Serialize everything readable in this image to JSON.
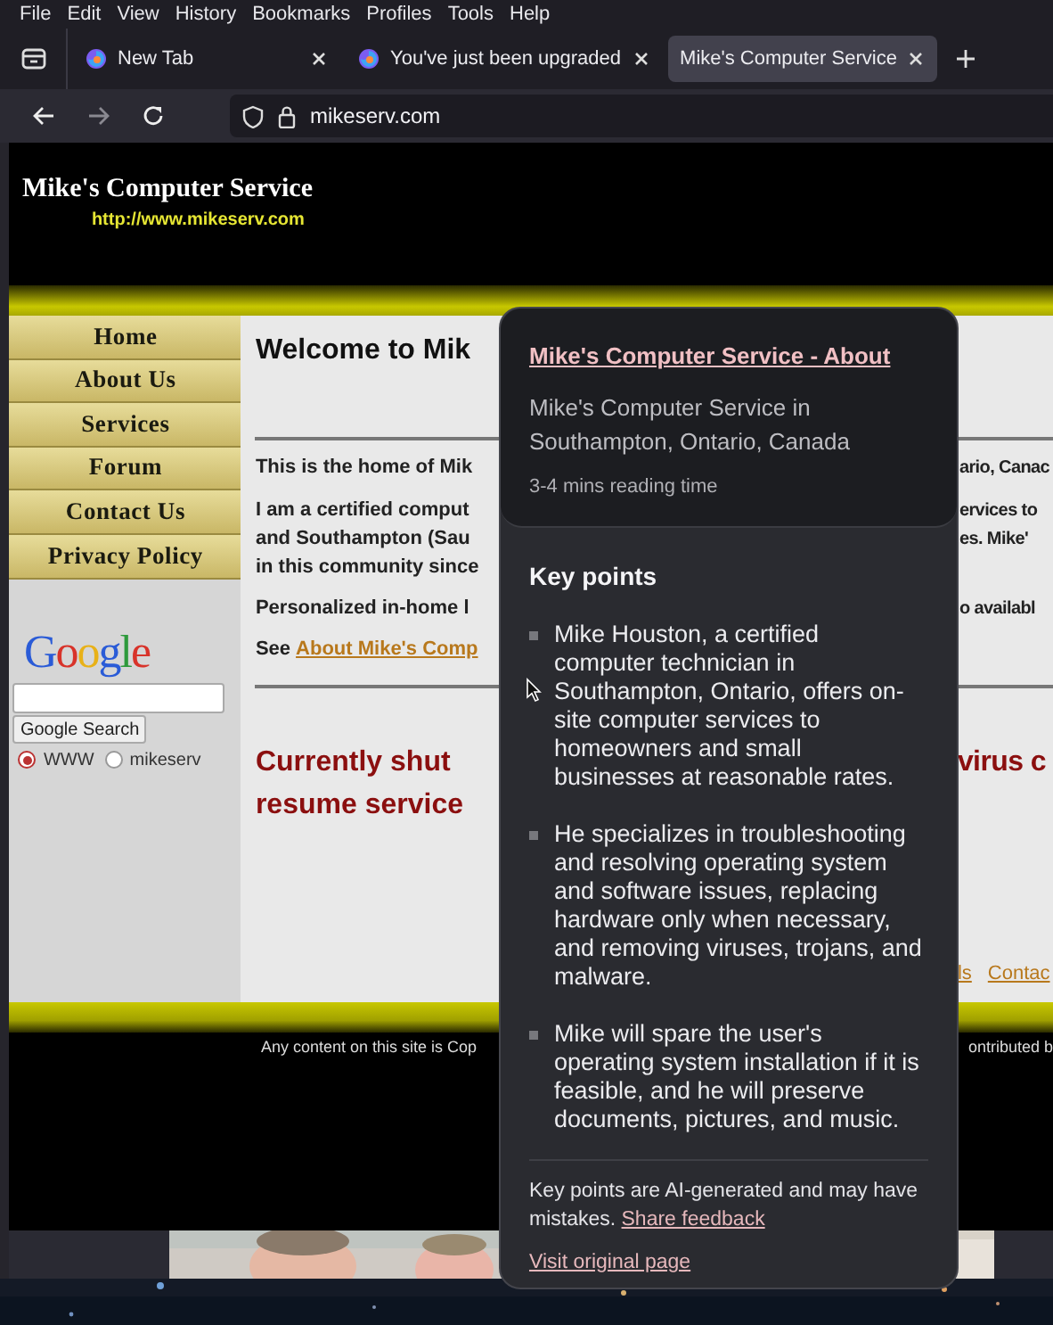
{
  "menu_bar": [
    "File",
    "Edit",
    "View",
    "History",
    "Bookmarks",
    "Profiles",
    "Tools",
    "Help"
  ],
  "tabs": [
    {
      "title": "New Tab",
      "selected": false
    },
    {
      "title": "You've just been upgraded",
      "selected": false
    },
    {
      "title": "Mike's Computer Service",
      "selected": true
    }
  ],
  "address_bar": {
    "url": "mikeserv.com"
  },
  "site": {
    "title": "Mike's Computer Service",
    "url": "http://www.mikeserv.com",
    "nav": [
      "Home",
      "About Us",
      "Services",
      "Forum",
      "Contact Us",
      "Privacy Policy"
    ],
    "search": {
      "logo": "Google",
      "button": "Google Search",
      "options": [
        {
          "label": "WWW",
          "selected": true
        },
        {
          "label": "mikeserv",
          "selected": false
        }
      ]
    },
    "content": [
      {
        "kind": "heading",
        "left": "Welcome to Mik"
      },
      {
        "kind": "rule"
      },
      {
        "kind": "text",
        "left": "This is the home of Mik",
        "right": "ario, Canac"
      },
      {
        "kind": "para",
        "left": "I am a certified comput",
        "right": "ervices to"
      },
      {
        "kind": "line",
        "left": "and Southampton (Sau",
        "right": "es. Mike'"
      },
      {
        "kind": "line",
        "left": "in this community since"
      },
      {
        "kind": "text",
        "left": "Personalized in-home l",
        "right": "o availabl"
      },
      {
        "kind": "link",
        "left": "See",
        "link": "About Mike's Comp"
      },
      {
        "kind": "rule"
      },
      {
        "kind": "alert",
        "left": "Currently shut",
        "right": "virus c"
      },
      {
        "kind": "alert_line",
        "left": "resume service"
      }
    ],
    "footer_links": [
      "ls",
      "Contac"
    ],
    "footer_text": {
      "left": "Any content on this site is Cop",
      "right": "ontributed b"
    }
  },
  "popup": {
    "title": "Mike's Computer Service - About",
    "subtitle": "Mike's Computer Service in Southampton, Ontario, Canada",
    "reading_time": "3-4 mins reading time",
    "heading": "Key points",
    "points": [
      "Mike Houston, a certified computer technician in Southampton, Ontario, offers on-site computer services to homeowners and small businesses at reasonable rates.",
      "He specializes in troubleshooting and resolving operating system and software issues, replacing hardware only when necessary, and removing viruses, trojans, and malware.",
      "Mike will spare the user's operating system installation if it is feasible, and he will preserve documents, pictures, and music."
    ],
    "disclaimer": "Key points are AI-generated and may have mistakes.",
    "feedback_link": "Share feedback",
    "visit_link": "Visit original page"
  }
}
